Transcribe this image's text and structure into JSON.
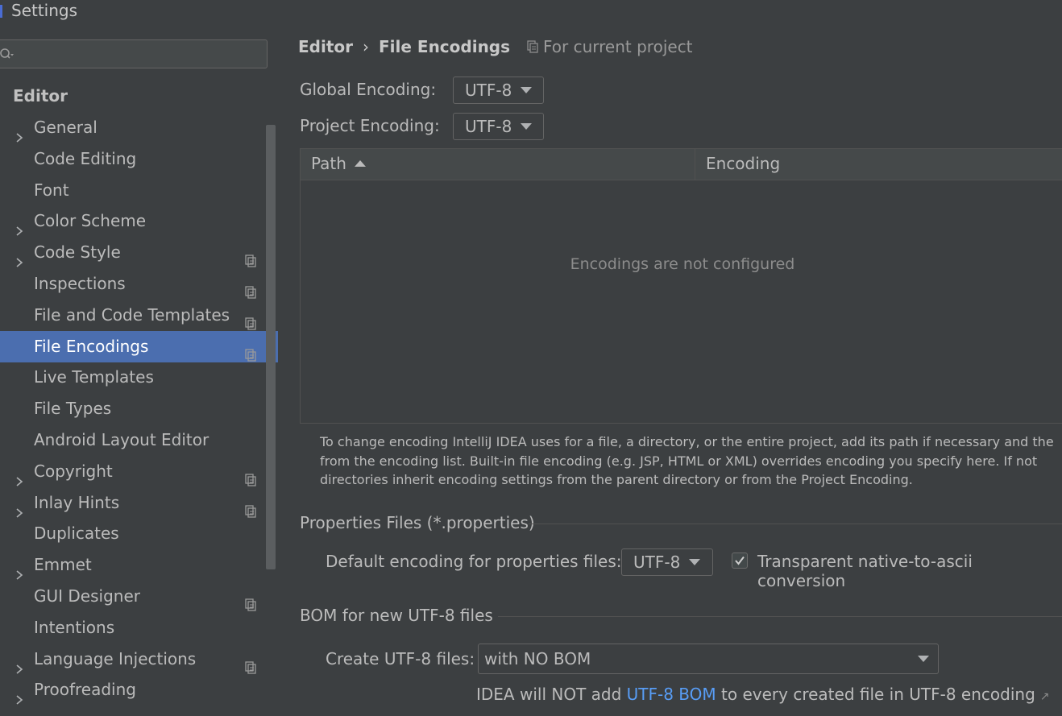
{
  "window": {
    "title": "Settings"
  },
  "sidebar": {
    "search": {
      "value": "",
      "placeholder": ""
    },
    "group_header": "Editor",
    "items": [
      {
        "label": "General",
        "expandable": true,
        "project_scoped": false,
        "selected": false
      },
      {
        "label": "Code Editing",
        "expandable": false,
        "project_scoped": false,
        "selected": false
      },
      {
        "label": "Font",
        "expandable": false,
        "project_scoped": false,
        "selected": false
      },
      {
        "label": "Color Scheme",
        "expandable": true,
        "project_scoped": false,
        "selected": false
      },
      {
        "label": "Code Style",
        "expandable": true,
        "project_scoped": true,
        "selected": false
      },
      {
        "label": "Inspections",
        "expandable": false,
        "project_scoped": true,
        "selected": false
      },
      {
        "label": "File and Code Templates",
        "expandable": false,
        "project_scoped": true,
        "selected": false
      },
      {
        "label": "File Encodings",
        "expandable": false,
        "project_scoped": true,
        "selected": true
      },
      {
        "label": "Live Templates",
        "expandable": false,
        "project_scoped": false,
        "selected": false
      },
      {
        "label": "File Types",
        "expandable": false,
        "project_scoped": false,
        "selected": false
      },
      {
        "label": "Android Layout Editor",
        "expandable": false,
        "project_scoped": false,
        "selected": false
      },
      {
        "label": "Copyright",
        "expandable": true,
        "project_scoped": true,
        "selected": false
      },
      {
        "label": "Inlay Hints",
        "expandable": true,
        "project_scoped": true,
        "selected": false
      },
      {
        "label": "Duplicates",
        "expandable": false,
        "project_scoped": false,
        "selected": false
      },
      {
        "label": "Emmet",
        "expandable": true,
        "project_scoped": false,
        "selected": false
      },
      {
        "label": "GUI Designer",
        "expandable": false,
        "project_scoped": true,
        "selected": false
      },
      {
        "label": "Intentions",
        "expandable": false,
        "project_scoped": false,
        "selected": false
      },
      {
        "label": "Language Injections",
        "expandable": true,
        "project_scoped": true,
        "selected": false
      },
      {
        "label": "Proofreading",
        "expandable": true,
        "project_scoped": false,
        "selected": false
      }
    ]
  },
  "content": {
    "breadcrumb": {
      "parent": "Editor",
      "separator": "›",
      "current": "File Encodings"
    },
    "scope_label": "For current project",
    "global_encoding": {
      "label": "Global Encoding:",
      "value": "UTF-8"
    },
    "project_encoding": {
      "label": "Project Encoding:",
      "value": "UTF-8"
    },
    "table": {
      "columns": [
        "Path",
        "Encoding"
      ],
      "sorted_column": "Path",
      "sort_direction": "ascending",
      "empty_text": "Encodings are not configured",
      "rows": []
    },
    "help_lines": [
      "To change encoding IntelliJ IDEA uses for a file, a directory, or the entire project, add its path if necessary and the",
      "from the encoding list. Built-in file encoding (e.g. JSP, HTML or XML) overrides encoding you specify here. If not",
      "directories inherit encoding settings from the parent directory or from the Project Encoding."
    ],
    "properties_section": {
      "title": "Properties Files (*.properties)",
      "default_label": "Default encoding for properties files:",
      "default_value": "UTF-8",
      "transparent_label": "Transparent native-to-ascii conversion",
      "transparent_checked": true
    },
    "bom_section": {
      "title": "BOM for new UTF-8 files",
      "create_label": "Create UTF-8 files:",
      "create_value": "with NO BOM",
      "note_before": "IDEA will NOT add ",
      "note_link": "UTF-8 BOM",
      "note_after": " to every created file in UTF-8 encoding",
      "note_link_icon": "external-link-icon"
    }
  },
  "colors": {
    "background": "#3c3f41",
    "selection": "#4b6eaf",
    "link": "#589df6",
    "text": "#bbbbbb"
  }
}
